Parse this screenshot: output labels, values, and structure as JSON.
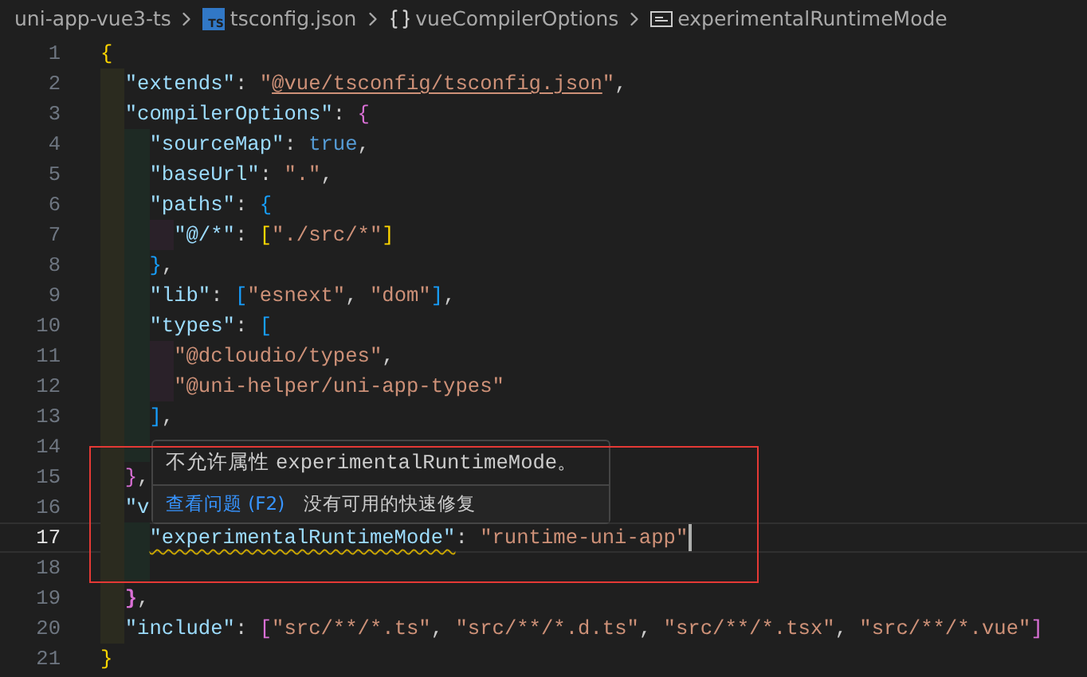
{
  "breadcrumbs": [
    {
      "kind": "folder",
      "label": "uni-app-vue3-ts"
    },
    {
      "kind": "file",
      "badge": "TS",
      "label": "tsconfig.json"
    },
    {
      "kind": "object",
      "label": "vueCompilerOptions"
    },
    {
      "kind": "property",
      "label": "experimentalRuntimeMode"
    }
  ],
  "editor": {
    "lines": [
      {
        "number": "1",
        "current": false,
        "tokens": [
          {
            "kind": "bracket",
            "color": "#ffd700",
            "text": "{"
          }
        ],
        "children": [
          {
            "number": "2",
            "current": false,
            "tokens": [
              {
                "kind": "key",
                "text": "\"extends\""
              },
              {
                "kind": "punct",
                "text": ": "
              },
              {
                "kind": "string",
                "text": "\""
              },
              {
                "kind": "link",
                "text": "@vue/tsconfig/tsconfig.json"
              },
              {
                "kind": "string",
                "text": "\""
              },
              {
                "kind": "punct",
                "text": ","
              }
            ]
          },
          {
            "number": "3",
            "current": false,
            "tokens": [
              {
                "kind": "key",
                "text": "\"compilerOptions\""
              },
              {
                "kind": "punct",
                "text": ": "
              },
              {
                "kind": "bracket",
                "color": "#da70d6",
                "text": "{"
              }
            ],
            "children": [
              {
                "number": "4",
                "current": false,
                "tokens": [
                  {
                    "kind": "key",
                    "text": "\"sourceMap\""
                  },
                  {
                    "kind": "punct",
                    "text": ": "
                  },
                  {
                    "kind": "keyword",
                    "text": "true"
                  },
                  {
                    "kind": "punct",
                    "text": ","
                  }
                ]
              },
              {
                "number": "5",
                "current": false,
                "tokens": [
                  {
                    "kind": "key",
                    "text": "\"baseUrl\""
                  },
                  {
                    "kind": "punct",
                    "text": ": "
                  },
                  {
                    "kind": "string",
                    "text": "\".\""
                  },
                  {
                    "kind": "punct",
                    "text": ","
                  }
                ]
              },
              {
                "number": "6",
                "current": false,
                "tokens": [
                  {
                    "kind": "key",
                    "text": "\"paths\""
                  },
                  {
                    "kind": "punct",
                    "text": ": "
                  },
                  {
                    "kind": "bracket",
                    "color": "#179fff",
                    "text": "{"
                  }
                ],
                "children": [
                  {
                    "number": "7",
                    "current": false,
                    "tokens": [
                      {
                        "kind": "key",
                        "text": "\"@/*\""
                      },
                      {
                        "kind": "punct",
                        "text": ": "
                      },
                      {
                        "kind": "bracket",
                        "color": "#ffd700",
                        "text": "["
                      },
                      {
                        "kind": "string",
                        "text": "\"./src/*\""
                      },
                      {
                        "kind": "bracket",
                        "color": "#ffd700",
                        "text": "]"
                      }
                    ]
                  }
                ]
              },
              {
                "number": "8",
                "current": false,
                "tokens": [
                  {
                    "kind": "bracket",
                    "color": "#179fff",
                    "text": "}"
                  },
                  {
                    "kind": "punct",
                    "text": ","
                  }
                ]
              },
              {
                "number": "9",
                "current": false,
                "tokens": [
                  {
                    "kind": "key",
                    "text": "\"lib\""
                  },
                  {
                    "kind": "punct",
                    "text": ": "
                  },
                  {
                    "kind": "bracket",
                    "color": "#179fff",
                    "text": "["
                  },
                  {
                    "kind": "string",
                    "text": "\"esnext\""
                  },
                  {
                    "kind": "punct",
                    "text": ", "
                  },
                  {
                    "kind": "string",
                    "text": "\"dom\""
                  },
                  {
                    "kind": "bracket",
                    "color": "#179fff",
                    "text": "]"
                  },
                  {
                    "kind": "punct",
                    "text": ","
                  }
                ]
              },
              {
                "number": "10",
                "current": false,
                "tokens": [
                  {
                    "kind": "key",
                    "text": "\"types\""
                  },
                  {
                    "kind": "punct",
                    "text": ": "
                  },
                  {
                    "kind": "bracket",
                    "color": "#179fff",
                    "text": "["
                  }
                ],
                "children": [
                  {
                    "number": "11",
                    "current": false,
                    "tokens": [
                      {
                        "kind": "string",
                        "text": "\"@dcloudio/types\""
                      },
                      {
                        "kind": "punct",
                        "text": ","
                      }
                    ]
                  },
                  {
                    "number": "12",
                    "current": false,
                    "tokens": [
                      {
                        "kind": "string",
                        "text": "\"@uni-helper/uni-app-types\""
                      }
                    ]
                  }
                ]
              },
              {
                "number": "13",
                "current": false,
                "tokens": [
                  {
                    "kind": "bracket",
                    "color": "#179fff",
                    "text": "]"
                  },
                  {
                    "kind": "punct",
                    "text": ","
                  }
                ]
              },
              {
                "number": "14",
                "current": false
              }
            ]
          },
          {
            "number": "15",
            "current": false,
            "tokens": [
              {
                "kind": "bracket",
                "color": "#da70d6",
                "text": "}"
              },
              {
                "kind": "punct",
                "text": ","
              }
            ]
          },
          {
            "number": "16",
            "current": false,
            "tokens": [
              {
                "kind": "key",
                "text": "\"v"
              }
            ],
            "children": [
              {
                "number": "17",
                "current": true,
                "tokens": [
                  {
                    "kind": "key",
                    "warning": true,
                    "text": "\"experimentalRuntimeMode\""
                  },
                  {
                    "kind": "punct",
                    "text": ": "
                  },
                  {
                    "kind": "string",
                    "text": "\"runtime-uni-app\""
                  }
                ]
              },
              {
                "number": "18",
                "current": false
              }
            ]
          },
          {
            "number": "19",
            "current": false,
            "tokens": [
              {
                "kind": "bracket",
                "color": "#da70d6",
                "matched": true,
                "text": "}"
              },
              {
                "kind": "punct",
                "text": ","
              }
            ]
          },
          {
            "number": "20",
            "current": false,
            "tokens": [
              {
                "kind": "key",
                "text": "\"include\""
              },
              {
                "kind": "punct",
                "text": ": "
              },
              {
                "kind": "bracket",
                "color": "#da70d6",
                "text": "["
              },
              {
                "kind": "string",
                "text": "\"src/**/*.ts\""
              },
              {
                "kind": "punct",
                "text": ", "
              },
              {
                "kind": "string",
                "text": "\"src/**/*.d.ts\""
              },
              {
                "kind": "punct",
                "text": ", "
              },
              {
                "kind": "string",
                "text": "\"src/**/*.tsx\""
              },
              {
                "kind": "punct",
                "text": ", "
              },
              {
                "kind": "string",
                "text": "\"src/**/*.vue\""
              },
              {
                "kind": "bracket",
                "color": "#da70d6",
                "text": "]"
              }
            ]
          }
        ]
      },
      {
        "number": "21",
        "current": false,
        "tokens": [
          {
            "kind": "bracket",
            "color": "#ffd700",
            "text": "}"
          }
        ]
      }
    ],
    "hover": {
      "message": [
        {
          "kind": "text",
          "text": "不允许属性 "
        },
        {
          "kind": "code",
          "text": "experimentalRuntimeMode"
        },
        {
          "kind": "text",
          "text": "。"
        }
      ],
      "link": "查看问题 (F2)",
      "note": "没有可用的快速修复"
    },
    "annotation_frame": true
  }
}
